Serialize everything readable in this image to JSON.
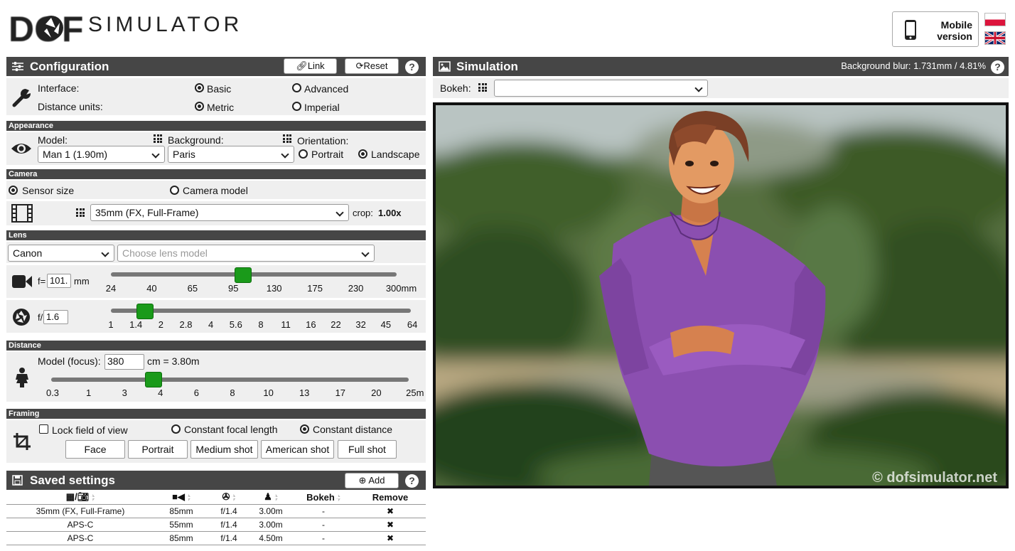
{
  "header": {
    "logo_text": "DOF",
    "brand": "SIMULATOR",
    "mobile_label_1": "Mobile",
    "mobile_label_2": "version"
  },
  "config": {
    "title": "Configuration",
    "link_label": "Link",
    "reset_label": "Reset",
    "help": "?",
    "interface_label": "Interface:",
    "interface_basic": "Basic",
    "interface_advanced": "Advanced",
    "units_label": "Distance units:",
    "units_metric": "Metric",
    "units_imperial": "Imperial"
  },
  "appearance": {
    "title": "Appearance",
    "model_label": "Model:",
    "model_value": "Man 1 (1.90m)",
    "background_label": "Background:",
    "background_value": "Paris",
    "orientation_label": "Orientation:",
    "portrait": "Portrait",
    "landscape": "Landscape"
  },
  "camera": {
    "title": "Camera",
    "sensor_size": "Sensor size",
    "camera_model": "Camera model",
    "sensor_value": "35mm (FX, Full-Frame)",
    "crop_label": "crop:",
    "crop_value": "1.00x"
  },
  "lens": {
    "title": "Lens",
    "brand_value": "Canon",
    "model_placeholder": "Choose lens model",
    "focal_prefix": "f=",
    "focal_value": "101.",
    "focal_unit": "mm",
    "focal_ticks": [
      "24",
      "40",
      "65",
      "95",
      "130",
      "175",
      "230",
      "300mm"
    ],
    "focal_position": 0.463,
    "aperture_prefix": "f/",
    "aperture_value": "1.6",
    "aperture_ticks": [
      "1",
      "1.4",
      "2",
      "2.8",
      "4",
      "5.6",
      "8",
      "11",
      "16",
      "22",
      "32",
      "45",
      "64"
    ],
    "aperture_position": 0.113
  },
  "distance": {
    "title": "Distance",
    "label": "Model (focus):",
    "value": "380",
    "suffix": "cm = 3.80m",
    "ticks": [
      "0.3",
      "1",
      "3",
      "4",
      "6",
      "8",
      "10",
      "13",
      "17",
      "20",
      "25m"
    ],
    "position": 0.28
  },
  "framing": {
    "title": "Framing",
    "lock_fov": "Lock field of view",
    "constant_focal": "Constant focal length",
    "constant_distance": "Constant distance",
    "buttons": [
      "Face",
      "Portrait",
      "Medium shot",
      "American shot",
      "Full shot"
    ]
  },
  "saved": {
    "title": "Saved settings",
    "add_label": "Add",
    "col_bokeh": "Bokeh",
    "col_remove": "Remove",
    "rows": [
      {
        "sensor": "35mm (FX, Full-Frame)",
        "focal": "85mm",
        "aperture": "f/1.4",
        "distance": "3.00m",
        "bokeh": "-",
        "remove": "✖"
      },
      {
        "sensor": "APS-C",
        "focal": "55mm",
        "aperture": "f/1.4",
        "distance": "3.00m",
        "bokeh": "-",
        "remove": "✖"
      },
      {
        "sensor": "APS-C",
        "focal": "85mm",
        "aperture": "f/1.4",
        "distance": "4.50m",
        "bokeh": "-",
        "remove": "✖"
      }
    ]
  },
  "simulation": {
    "title": "Simulation",
    "blur_text": "Background blur: 1.731mm / 4.81%",
    "bokeh_label": "Bokeh:",
    "bokeh_value": "",
    "watermark": "© dofsimulator.net"
  },
  "colors": {
    "bar": "#464646",
    "slider_thumb": "#1a9a1a",
    "shirt": "#8b4fb0"
  }
}
